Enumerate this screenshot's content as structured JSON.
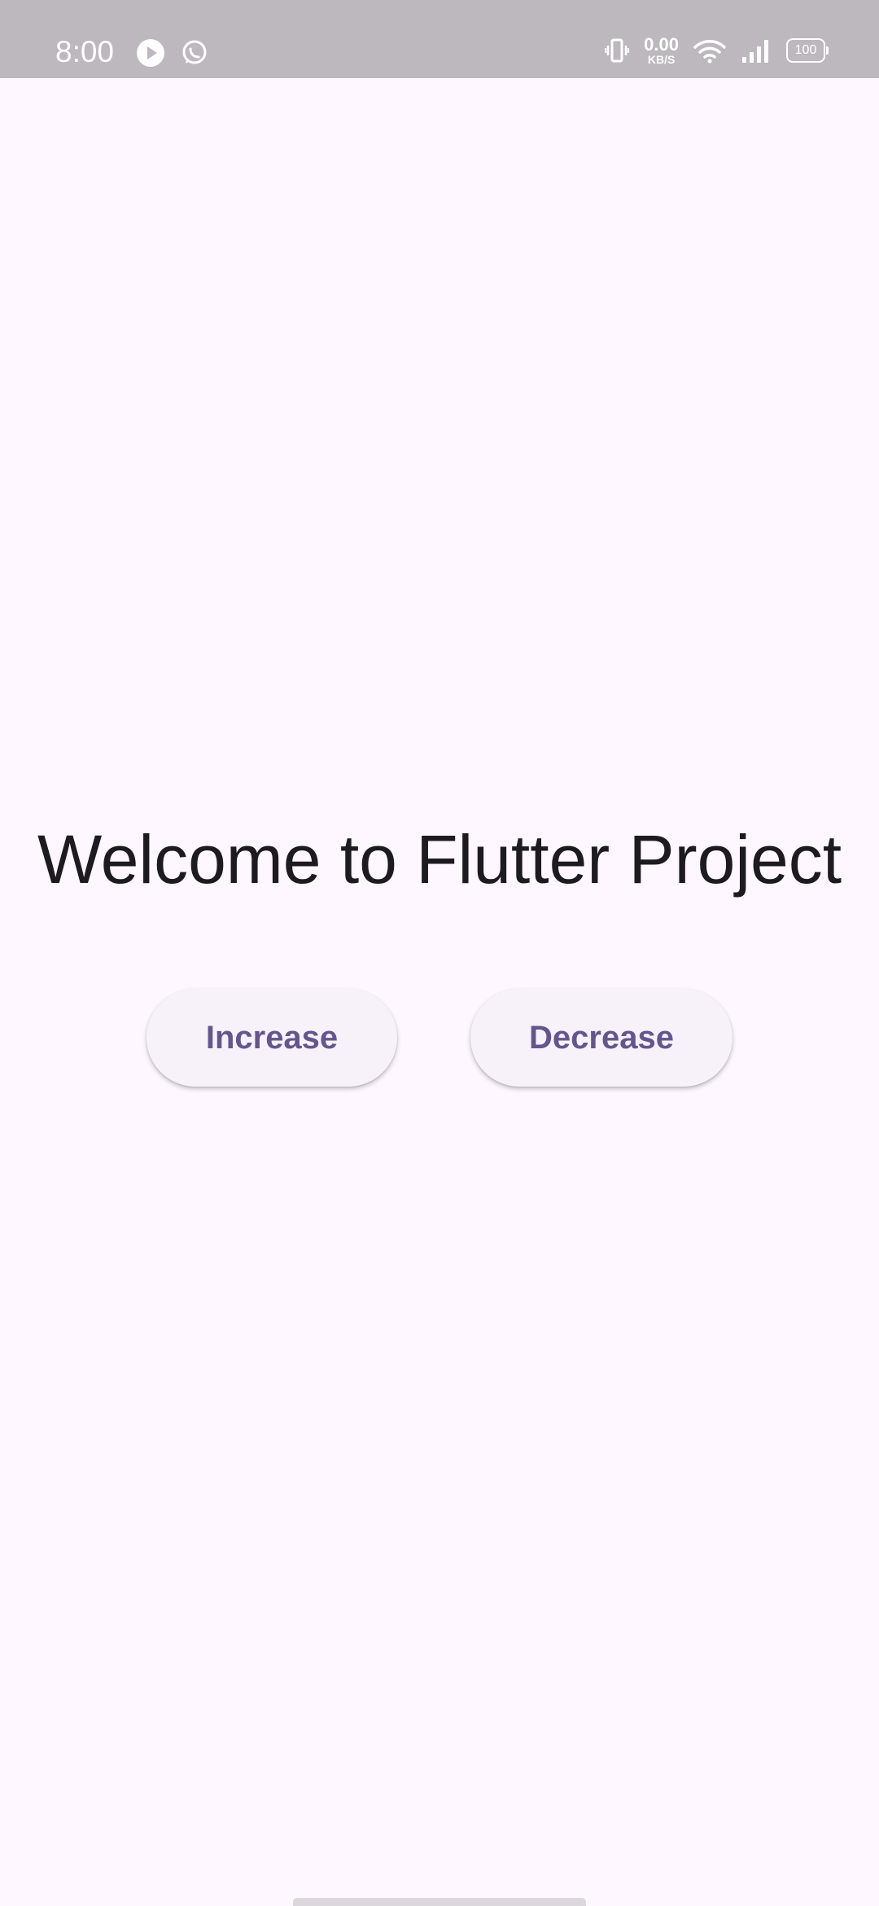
{
  "status_bar": {
    "time": "8:00",
    "left_icons": [
      "play-icon",
      "whatsapp-icon"
    ],
    "net_speed_value": "0.00",
    "net_speed_unit": "KB/S",
    "right_icons": [
      "vibrate-icon",
      "wifi-icon",
      "signal-icon",
      "battery-icon"
    ],
    "battery_level": "100"
  },
  "main": {
    "title": "Welcome to Flutter Project",
    "increase_label": "Increase",
    "decrease_label": "Decrease"
  },
  "colors": {
    "background": "#fef7ff",
    "status_bar": "#bcb8bd",
    "button_background": "#f7f2fa",
    "button_text": "#65558f",
    "title_text": "#1d1b20"
  }
}
